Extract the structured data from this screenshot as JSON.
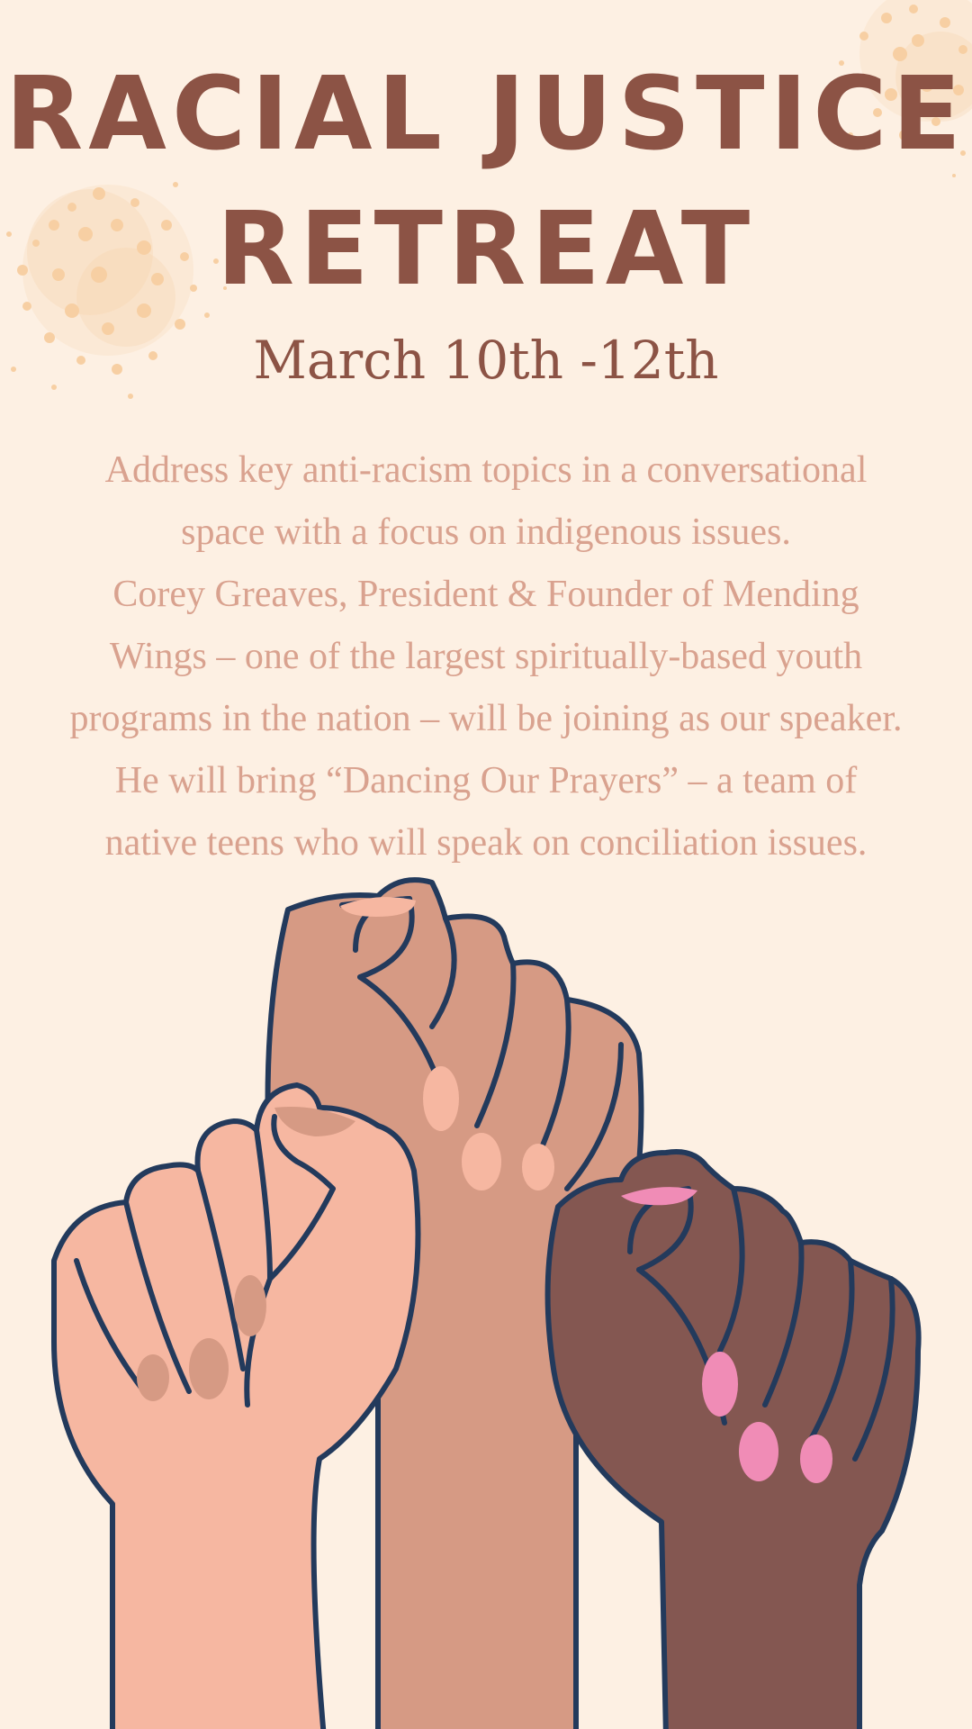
{
  "poster": {
    "title_line_1": "RACIAL JUSTICE",
    "title_line_2": "RETREAT",
    "dates": "March 10th -12th",
    "description_lines": [
      "Address key anti-racism topics in a conversational",
      "space with a focus on indigenous issues.",
      "Corey Greaves, President & Founder of Mending",
      "Wings – one of the largest spiritually-based youth",
      "programs in the nation – will be joining as our speaker.",
      "He will bring “Dancing Our Prayers” – a team of",
      "native teens who will speak on conciliation issues."
    ]
  },
  "illustration": {
    "subject": "three-raised-fists",
    "colors": {
      "background": "#FDF0E3",
      "title": "#8C5345",
      "body_text": "#D9A28F",
      "splatter": "#F5C58E",
      "outline": "#233A5C",
      "fist_light": "#F6B7A1",
      "fist_medium": "#D69A84",
      "fist_dark": "#845751",
      "nail_pink": "#F08CB6"
    }
  }
}
